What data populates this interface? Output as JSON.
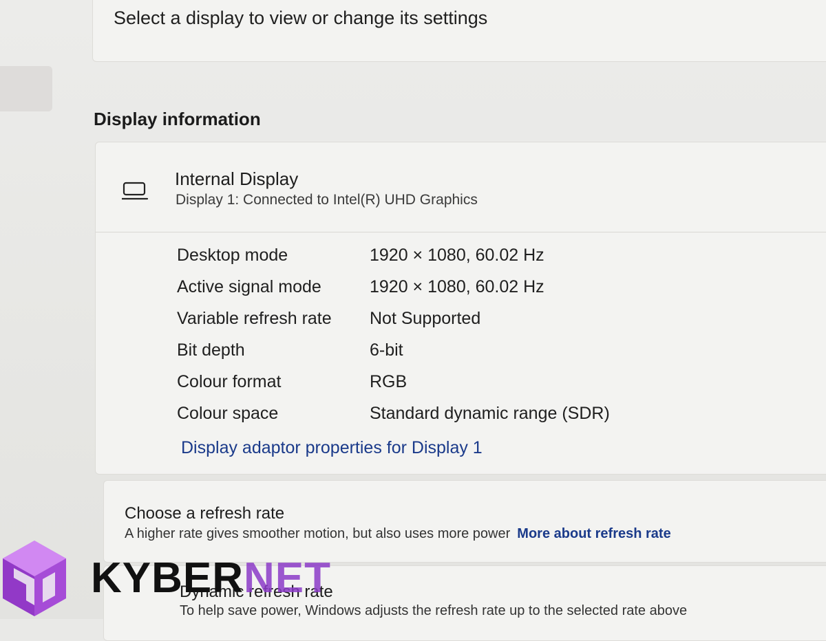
{
  "top_card": {
    "hint": "Select a display to view or change its settings"
  },
  "section": {
    "heading": "Display information"
  },
  "display": {
    "icon": "laptop-icon",
    "name": "Internal Display",
    "subtitle": "Display 1: Connected to Intel(R) UHD Graphics",
    "rows": [
      {
        "label": "Desktop mode",
        "value": "1920 × 1080, 60.02 Hz"
      },
      {
        "label": "Active signal mode",
        "value": "1920 × 1080, 60.02 Hz"
      },
      {
        "label": "Variable refresh rate",
        "value": "Not Supported"
      },
      {
        "label": "Bit depth",
        "value": "6-bit"
      },
      {
        "label": "Colour format",
        "value": "RGB"
      },
      {
        "label": "Colour space",
        "value": "Standard dynamic range (SDR)"
      }
    ],
    "adaptor_link": "Display adaptor properties for Display 1"
  },
  "refresh": {
    "title": "Choose a refresh rate",
    "description": "A higher rate gives smoother motion, but also uses more power",
    "link": "More about refresh rate"
  },
  "dynamic": {
    "title": "Dynamic refresh rate",
    "description": "To help save power, Windows adjusts the refresh rate up to the selected rate above"
  },
  "watermark": {
    "text_a": "KYBER",
    "text_b": "NET"
  },
  "colors": {
    "link": "#1a3a8a",
    "watermark_accent": "#8c3cc8"
  }
}
